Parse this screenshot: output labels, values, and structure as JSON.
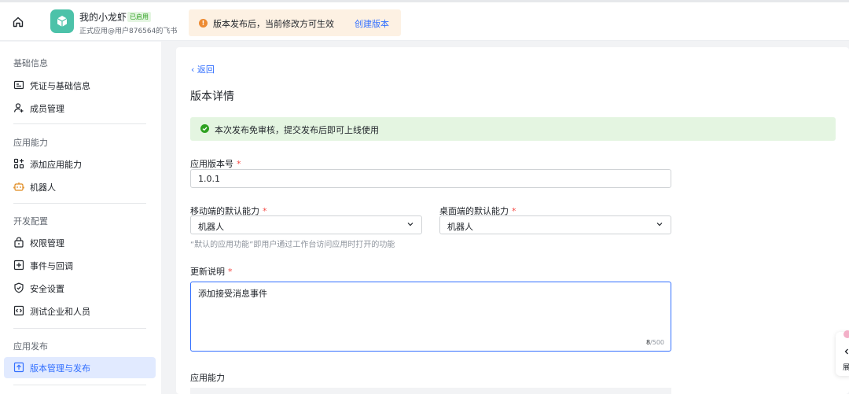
{
  "header": {
    "app_name": "我的小龙虾",
    "app_badge": "已启用",
    "app_subtitle": "正式应用@用户876564的飞书",
    "notice_text": "版本发布后，当前修改方可生效",
    "notice_link": "创建版本"
  },
  "sidebar": {
    "sections": [
      {
        "title": "基础信息",
        "items": [
          {
            "label": "凭证与基础信息",
            "icon": "id-card-icon"
          },
          {
            "label": "成员管理",
            "icon": "user-add-icon"
          }
        ]
      },
      {
        "title": "应用能力",
        "items": [
          {
            "label": "添加应用能力",
            "icon": "apps-add-icon"
          },
          {
            "label": "机器人",
            "icon": "robot-icon"
          }
        ]
      },
      {
        "title": "开发配置",
        "items": [
          {
            "label": "权限管理",
            "icon": "lock-icon"
          },
          {
            "label": "事件与回调",
            "icon": "event-icon"
          },
          {
            "label": "安全设置",
            "icon": "shield-icon"
          },
          {
            "label": "测试企业和人员",
            "icon": "code-icon"
          }
        ]
      },
      {
        "title": "应用发布",
        "items": [
          {
            "label": "版本管理与发布",
            "icon": "upload-icon",
            "active": true
          }
        ]
      }
    ]
  },
  "main": {
    "back_label": "返回",
    "title": "版本详情",
    "success_text": "本次发布免审核，提交发布后即可上线使用",
    "version_label": "应用版本号",
    "version_value": "1.0.1",
    "mobile_label": "移动端的默认能力",
    "mobile_value": "机器人",
    "desktop_label": "桌面端的默认能力",
    "desktop_value": "机器人",
    "default_hint": "“默认的应用功能”即用户通过工作台访问应用时打开的功能",
    "notes_label": "更新说明",
    "notes_value": "添加接受消息事件",
    "notes_count": "8",
    "notes_max": "/500",
    "capability_label": "应用能力",
    "required_mark": "*"
  },
  "float_tab": {
    "label": "展"
  },
  "colors": {
    "accent": "#3370ff",
    "success": "#2ea121",
    "warning": "#ed8b33",
    "active_bg": "#e1eaff"
  }
}
